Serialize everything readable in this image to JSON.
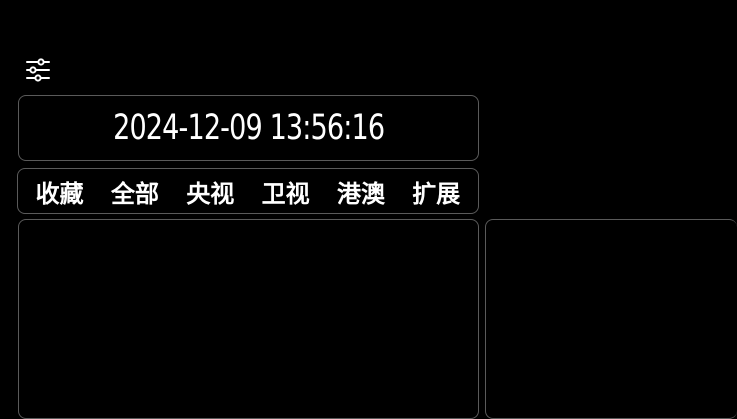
{
  "toolbar": {
    "settings_icon": "sliders-icon"
  },
  "clock": {
    "datetime": "2024-12-09 13:56:16"
  },
  "tabs": [
    {
      "label": "收藏"
    },
    {
      "label": "全部"
    },
    {
      "label": "央视"
    },
    {
      "label": "卫视"
    },
    {
      "label": "港澳"
    },
    {
      "label": "扩展"
    }
  ],
  "colors": {
    "background": "#000000",
    "border": "#5a5a5a",
    "text": "#ffffff"
  }
}
